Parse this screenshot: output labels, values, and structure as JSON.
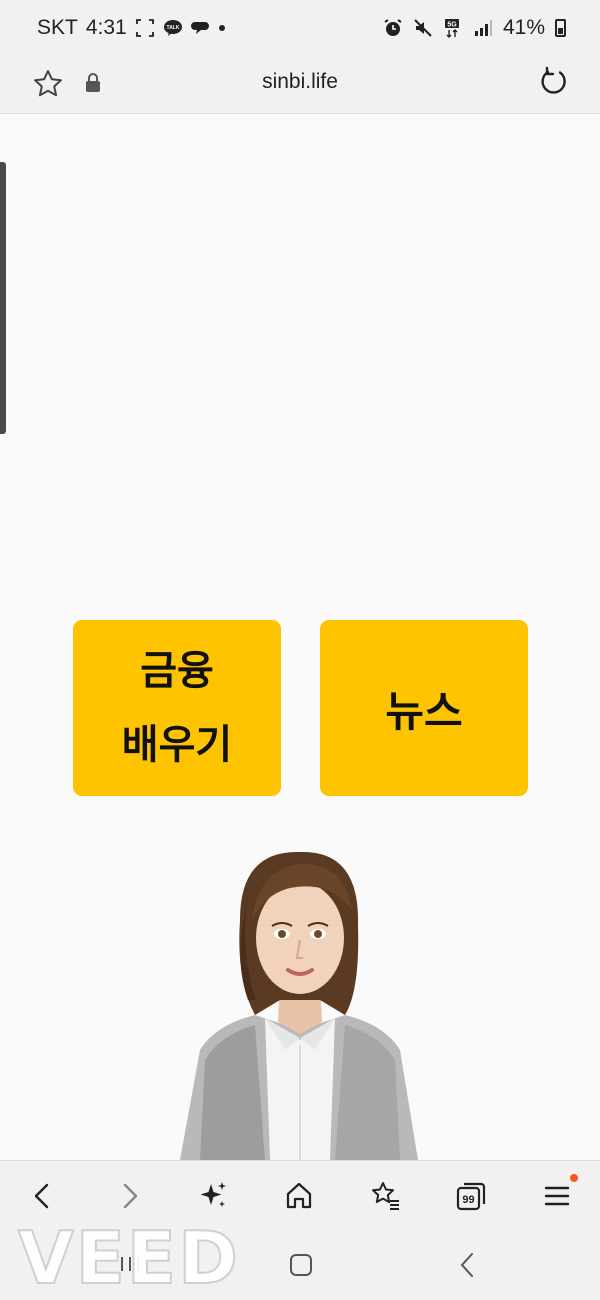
{
  "status_bar": {
    "carrier": "SKT",
    "time": "4:31",
    "battery": "41%",
    "icons": [
      "screenshot-frame-icon",
      "kakaotalk-icon",
      "chat-bubble-icon",
      "notification-dot",
      "alarm-icon",
      "mute-icon",
      "5g-icon",
      "signal-icon",
      "battery-icon"
    ]
  },
  "address_bar": {
    "url": "sinbi.life",
    "icons": [
      "favorite-star-icon",
      "lock-icon",
      "reload-icon"
    ]
  },
  "main": {
    "buttons": {
      "finance": {
        "line1": "금융",
        "line2": "배우기"
      },
      "news": {
        "label": "뉴스"
      }
    },
    "button_color": "#fec400"
  },
  "toolbar": {
    "items": [
      "back-icon",
      "forward-icon",
      "ai-sparkle-icon",
      "home-icon",
      "bookmarks-icon",
      "tabs-icon",
      "menu-icon"
    ],
    "tabs_count": "99",
    "badge_color": "#f05a28"
  },
  "watermark": {
    "text": "VEED"
  }
}
